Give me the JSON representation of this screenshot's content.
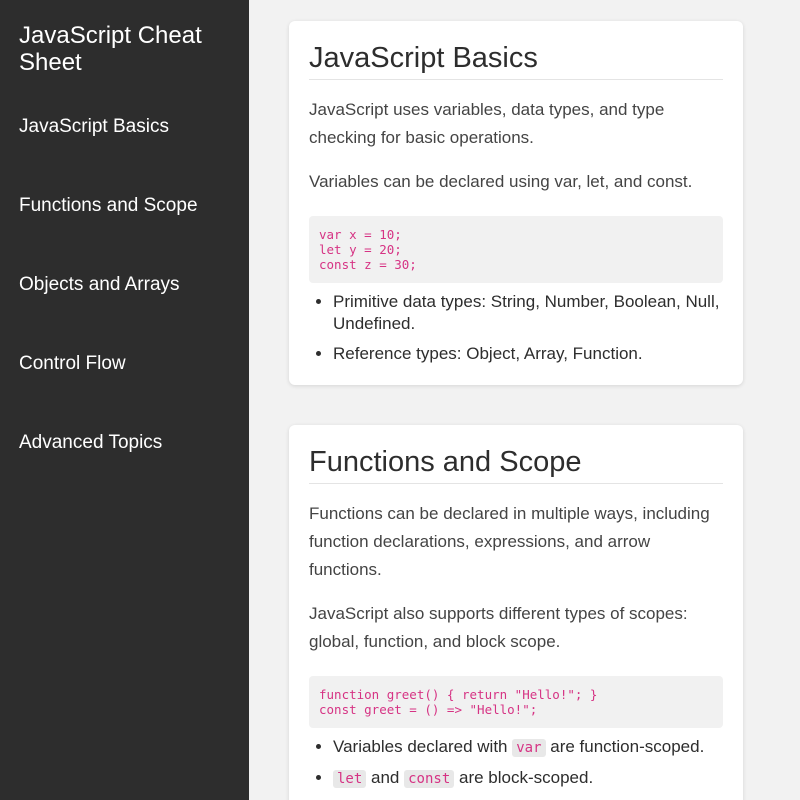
{
  "sidebar": {
    "title": "JavaScript Cheat Sheet",
    "items": [
      {
        "label": "JavaScript Basics"
      },
      {
        "label": "Functions and Scope"
      },
      {
        "label": "Objects and Arrays"
      },
      {
        "label": "Control Flow"
      },
      {
        "label": "Advanced Topics"
      }
    ]
  },
  "sections": [
    {
      "title": "JavaScript Basics",
      "paragraphs": [
        "JavaScript uses variables, data types, and type checking for basic operations.",
        "Variables can be declared using var, let, and const."
      ],
      "code": "var x = 10;\nlet y = 20;\nconst z = 30;",
      "bullets": [
        "Primitive data types: String, Number, Boolean, Null, Undefined.",
        "Reference types: Object, Array, Function."
      ]
    },
    {
      "title": "Functions and Scope",
      "paragraphs": [
        "Functions can be declared in multiple ways, including function declarations, expressions, and arrow functions.",
        "JavaScript also supports different types of scopes: global, function, and block scope."
      ],
      "code": "function greet() { return \"Hello!\"; }\nconst greet = () => \"Hello!\";",
      "bullets": [
        {
          "prefix": "Variables declared with ",
          "code": "var",
          "suffix": " are function-scoped."
        },
        {
          "code1": "let",
          "mid": " and ",
          "code2": "const",
          "suffix": " are block-scoped."
        }
      ]
    }
  ]
}
